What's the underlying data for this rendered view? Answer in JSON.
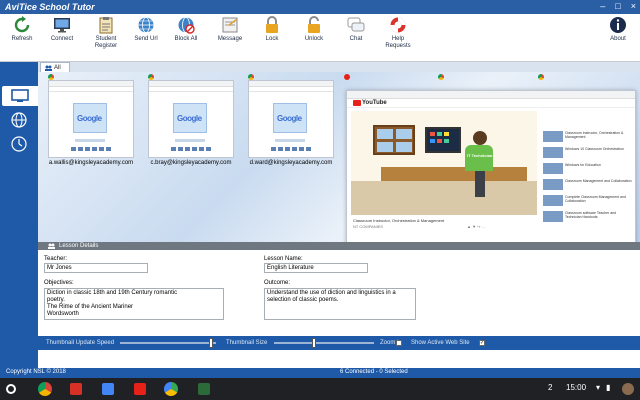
{
  "window": {
    "title": "AviTice School Tutor",
    "controls": [
      "–",
      "□",
      "×"
    ]
  },
  "toolbar": {
    "refresh": "Refresh",
    "connect": "Connect",
    "student_register_1": "Student",
    "student_register_2": "Register",
    "send_url": "Send Url",
    "block_all": "Block All",
    "message": "Message",
    "lock": "Lock",
    "unlock": "Unlock",
    "chat": "Chat",
    "help_1": "Help",
    "help_2": "Requests",
    "about": "About"
  },
  "tabs": {
    "all": "All"
  },
  "students": [
    {
      "email": "a.wallis@kingsleyacademy.com"
    },
    {
      "email": "c.bray@kingsleyacademy.com"
    },
    {
      "email": "d.ward@kingsleyacademy.com"
    }
  ],
  "video": {
    "site": "YouTube",
    "title": "Classroom Instructor, Orchestration & Management",
    "channel": "NT COMPANIES",
    "meta": "▲ ▼ ↪ …",
    "character_tag": "IT Technician",
    "related": [
      "Classroom Instructor, Orchestration & Management",
      "Windows 10 Classroom Orchestration",
      "Windows for Education",
      "Classroom Management and Collaboration",
      "Complete Classroom Management and Collaboration",
      "Classroom software Teacher and Technician Handouts"
    ]
  },
  "lesson": {
    "header": "Lesson Details",
    "teacher_label": "Teacher:",
    "teacher_value": "Mr Jones",
    "lesson_name_label": "Lesson Name:",
    "lesson_name_value": "English Literature",
    "objectives_label": "Objectives:",
    "objectives_line1": "Diction in classic 18th and 19th Century romantic",
    "objectives_line2": "poetry.",
    "objectives_line3": "The Rime of the Ancient Mariner",
    "objectives_line4": "Wordsworth",
    "outcome_label": "Outcome:",
    "outcome_line1": "Understand the use of diction and linguistics in a",
    "outcome_line2": "selection of classic poems."
  },
  "controls": {
    "thumb_speed": "Thumbnail Update Speed",
    "thumb_speed_level": 0.95,
    "thumb_size": "Thumbnail Size",
    "thumb_size_level": 0.4,
    "zoom_in": "Zoom In",
    "show_active": "Show Active Web Site",
    "checkmark": "✓"
  },
  "status": {
    "copyright": "Copyright NSL © 2018",
    "connected": "6 Connected - 0 Selected"
  },
  "taskbar": {
    "badge": "2",
    "time": "15:00"
  },
  "colors": {
    "titlebar": "#2a5fa6",
    "sidebar": "#1e5aa8",
    "taskbar": "#202124"
  }
}
